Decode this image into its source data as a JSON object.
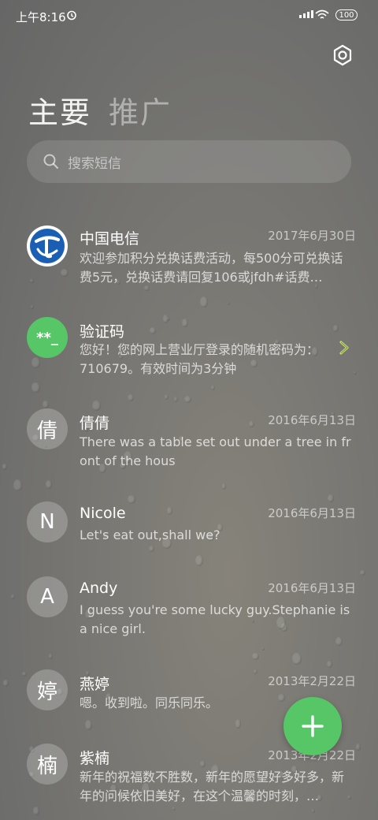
{
  "status_bar": {
    "time": "上午8:16",
    "battery": "100"
  },
  "tabs": [
    {
      "label": "主要",
      "active": true
    },
    {
      "label": "推广",
      "active": false
    }
  ],
  "search": {
    "placeholder": "搜索短信"
  },
  "conversations": [
    {
      "name": "中国电信",
      "date": "2017年6月30日",
      "preview": "欢迎参加积分兑换话费活动，每500分可兑换话费5元，兑换话费请回复106或jfdh#话费…",
      "avatar": "telecom-logo"
    },
    {
      "name": "验证码",
      "date": "",
      "preview": "您好！您的网上营业厅登录的随机密码为：710679。有效时间为3分钟",
      "avatar_text": "**_",
      "avatar_color": "#56c667"
    },
    {
      "name": "倩倩",
      "date": "2016年6月13日",
      "preview": "There was a table set out under a tree in front of the hous",
      "avatar_text": "倩"
    },
    {
      "name": "Nicole",
      "date": "2016年6月13日",
      "preview": "Let's eat out,shall we?",
      "avatar_text": "N"
    },
    {
      "name": "Andy",
      "date": "2016年6月13日",
      "preview": "I guess you're some lucky guy.Stephanie is a nice girl.",
      "avatar_text": "A"
    },
    {
      "name": "燕婷",
      "date": "2013年2月22日",
      "preview": "嗯。收到啦。同乐同乐。",
      "avatar_text": "婷"
    },
    {
      "name": "紫楠",
      "date": "2013年2月22日",
      "preview": "新年的祝福数不胜数，新年的愿望好多好多，新年的问候依旧美好，在这个温馨的时刻，…",
      "avatar_text": "楠"
    }
  ],
  "colors": {
    "fab": "#56c667",
    "telecom_blue": "#1a5fb4"
  }
}
